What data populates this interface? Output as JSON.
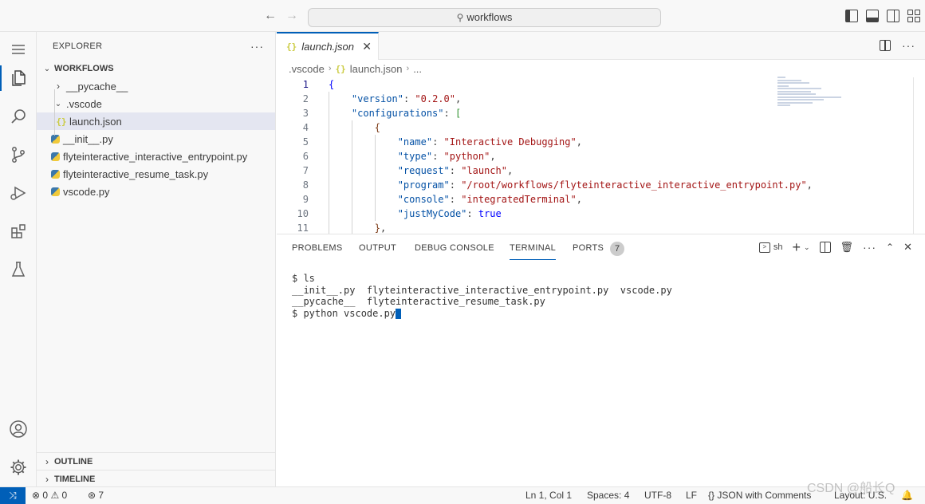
{
  "titlebar": {
    "search_text": "workflows"
  },
  "sidebar": {
    "title": "EXPLORER",
    "root_folder": "WORKFLOWS",
    "tree": [
      {
        "label": "__pycache__",
        "type": "folder-collapsed"
      },
      {
        "label": ".vscode",
        "type": "folder-expanded"
      },
      {
        "label": "launch.json",
        "type": "json",
        "selected": true
      },
      {
        "label": "__init__.py",
        "type": "python"
      },
      {
        "label": "flyteinteractive_interactive_entrypoint.py",
        "type": "python"
      },
      {
        "label": "flyteinteractive_resume_task.py",
        "type": "python"
      },
      {
        "label": "vscode.py",
        "type": "python"
      }
    ],
    "outline": "OUTLINE",
    "timeline": "TIMELINE"
  },
  "editor": {
    "tab_label": "launch.json",
    "breadcrumb": [
      ".vscode",
      "launch.json",
      "..."
    ],
    "line_numbers": [
      "1",
      "2",
      "3",
      "4",
      "5",
      "6",
      "7",
      "8",
      "9",
      "10",
      "11"
    ],
    "current_line": "1"
  },
  "panel": {
    "tabs": [
      "PROBLEMS",
      "OUTPUT",
      "DEBUG CONSOLE",
      "TERMINAL",
      "PORTS"
    ],
    "active_tab": "TERMINAL",
    "ports_count": "7",
    "shell_label": "sh",
    "terminal_lines": [
      "$ ls",
      "__init__.py  flyteinteractive_interactive_entrypoint.py  vscode.py",
      "__pycache__  flyteinteractive_resume_task.py",
      "$ python vscode.py"
    ]
  },
  "statusbar": {
    "errors": "0",
    "warnings": "0",
    "ports": "7",
    "position": "Ln 1, Col 1",
    "spaces": "Spaces: 4",
    "encoding": "UTF-8",
    "eol": "LF",
    "language": "JSON with Comments",
    "layout": "Layout: U.S."
  },
  "watermark": "CSDN @船长Q",
  "colors": {
    "accent": "#005fb8",
    "json_key": "#0451a5",
    "json_string": "#a31515",
    "json_bool": "#0000ff"
  }
}
